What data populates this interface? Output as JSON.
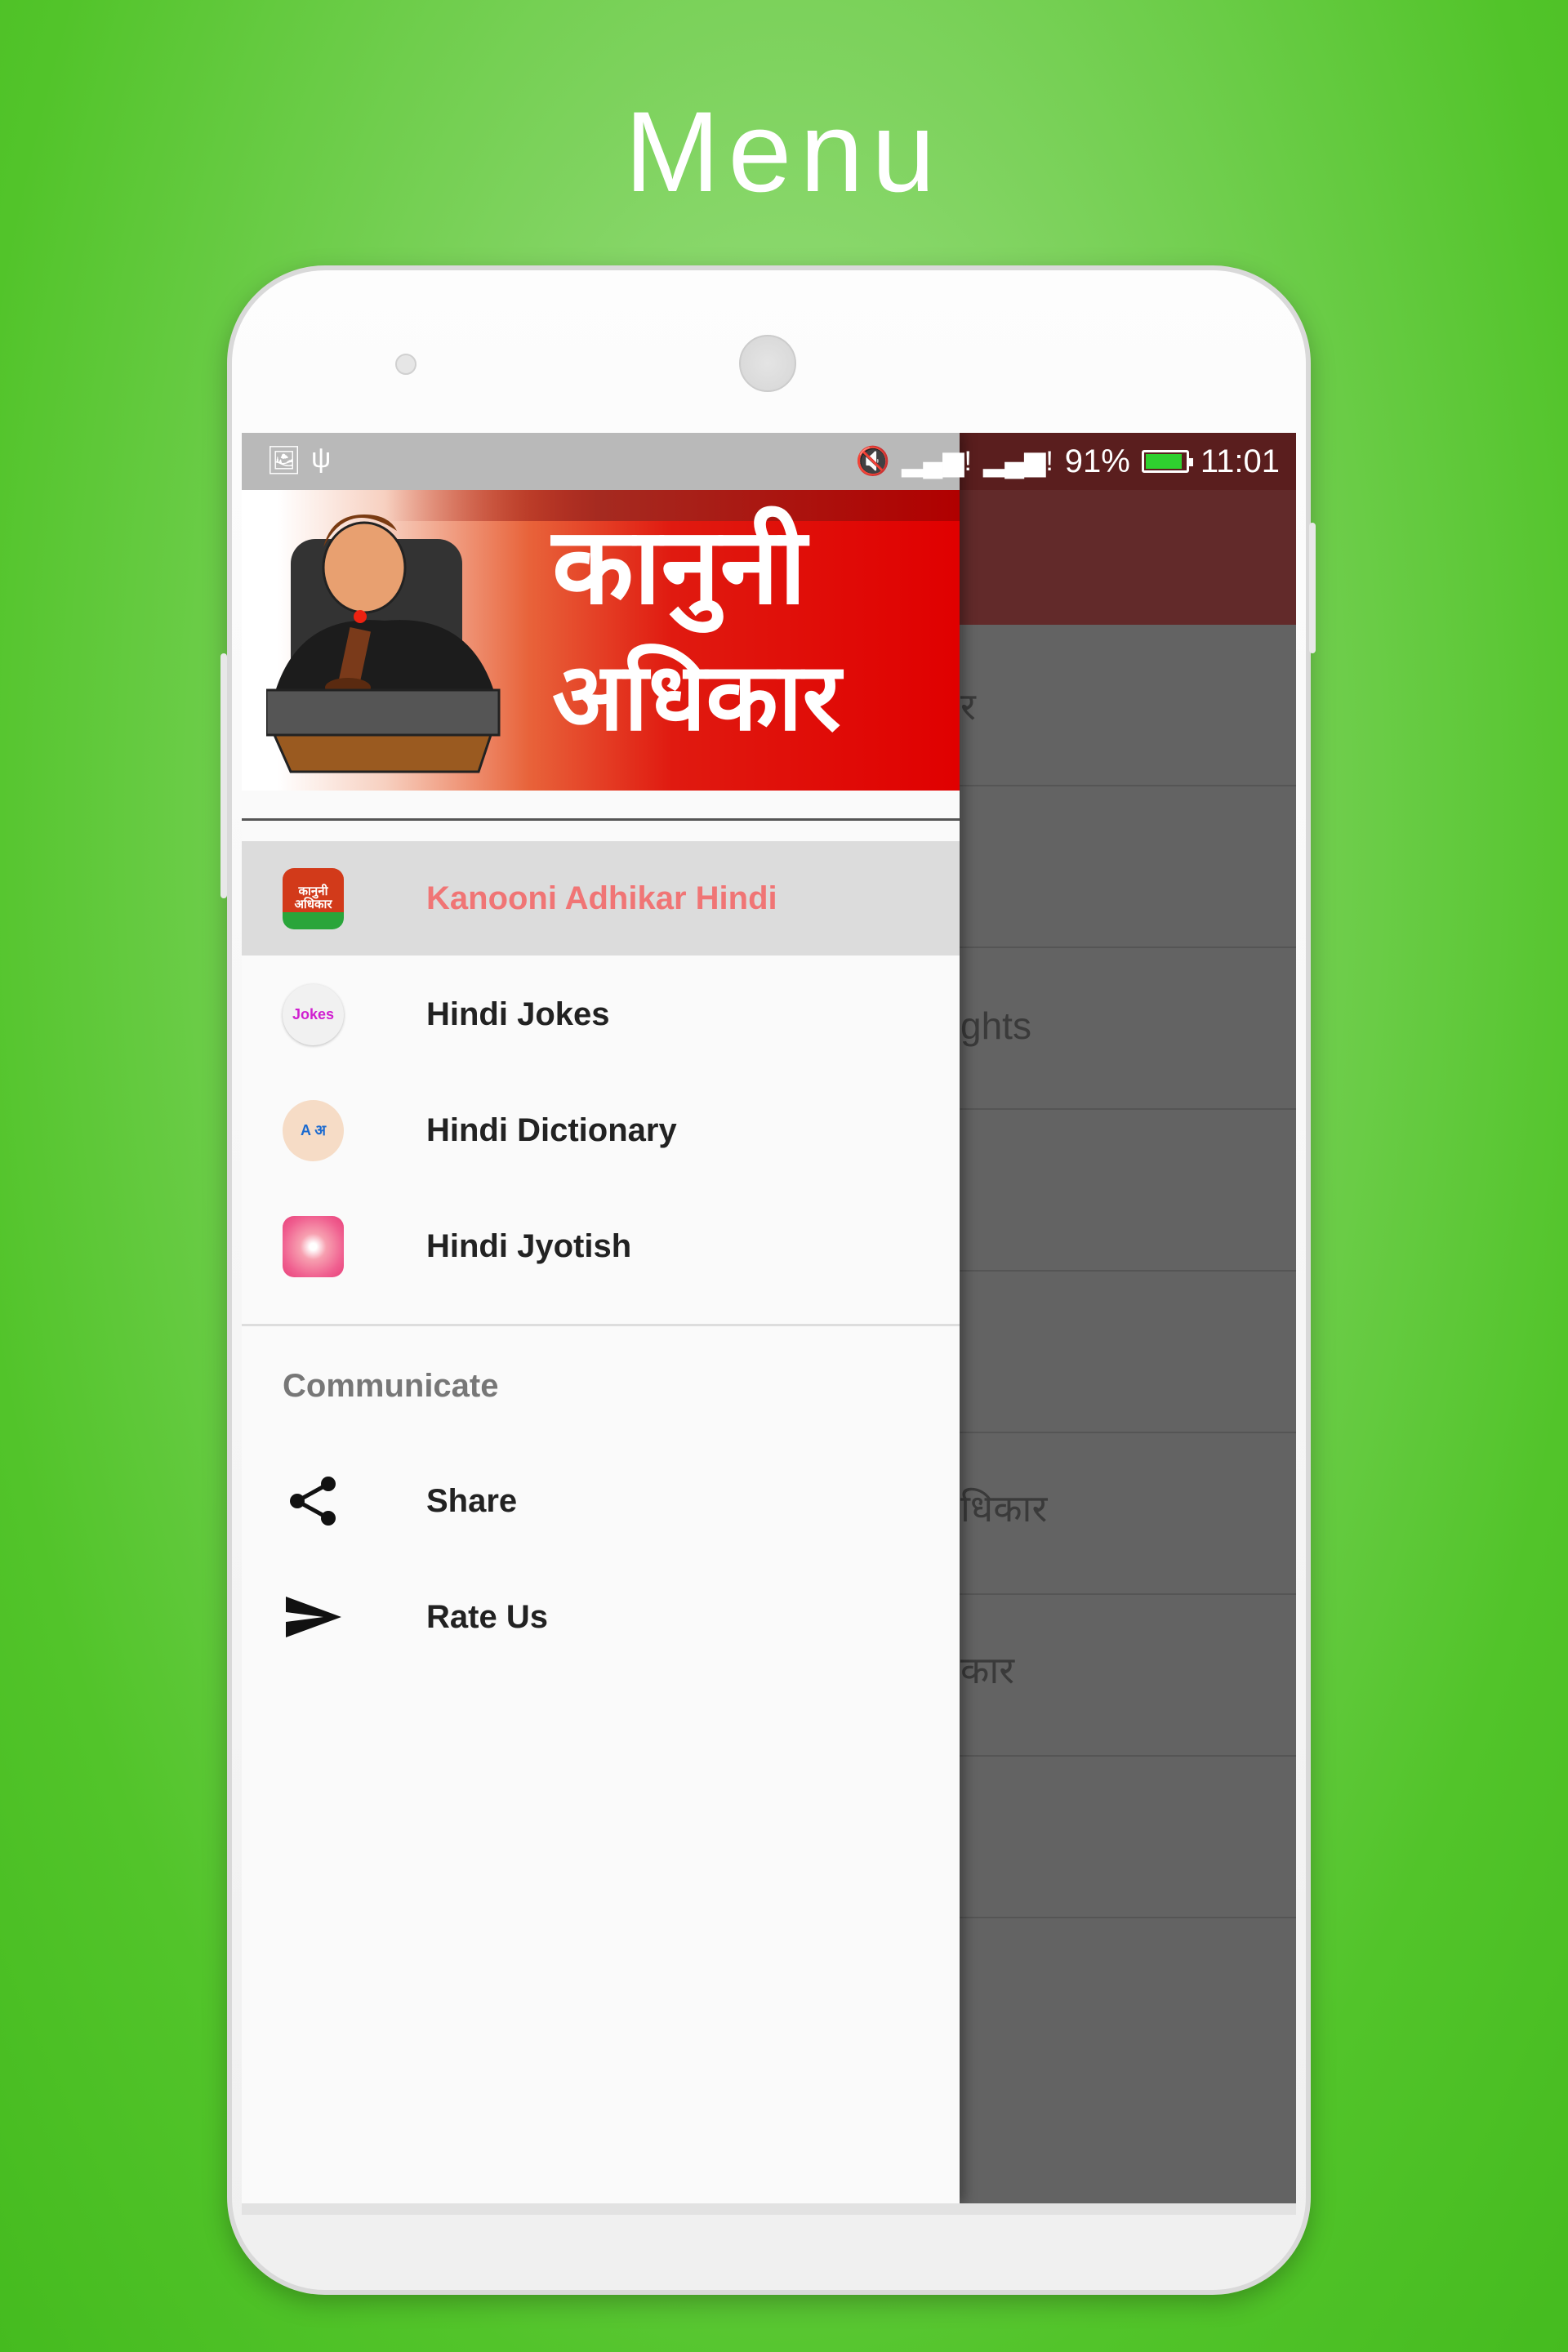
{
  "promo": {
    "title": "Menu"
  },
  "status_bar": {
    "battery": "91%",
    "battery_level": 91,
    "time": "11:01",
    "battery_color": "#2fd02f"
  },
  "header": {
    "title_line1": "कानुनी",
    "title_line2": "अधिकार"
  },
  "background_list": {
    "fragments": [
      "र",
      "ghts",
      "धिकार",
      "कार"
    ]
  },
  "drawer": {
    "items": [
      {
        "label": "Kanooni Adhikar Hindi",
        "icon": "kanooni-adhikar-app-icon",
        "icon_text": "कानुनी अधिकार",
        "selected": true
      },
      {
        "label": "Hindi Jokes",
        "icon": "hindi-jokes-app-icon",
        "icon_text": "Jokes"
      },
      {
        "label": "Hindi Dictionary",
        "icon": "hindi-dictionary-app-icon",
        "icon_text": "A अ"
      },
      {
        "label": "Hindi Jyotish",
        "icon": "hindi-jyotish-app-icon"
      }
    ],
    "section_title": "Communicate",
    "communicate": [
      {
        "label": "Share",
        "icon": "share-icon"
      },
      {
        "label": "Rate Us",
        "icon": "send-icon"
      }
    ],
    "selected_color": "#f07575"
  }
}
